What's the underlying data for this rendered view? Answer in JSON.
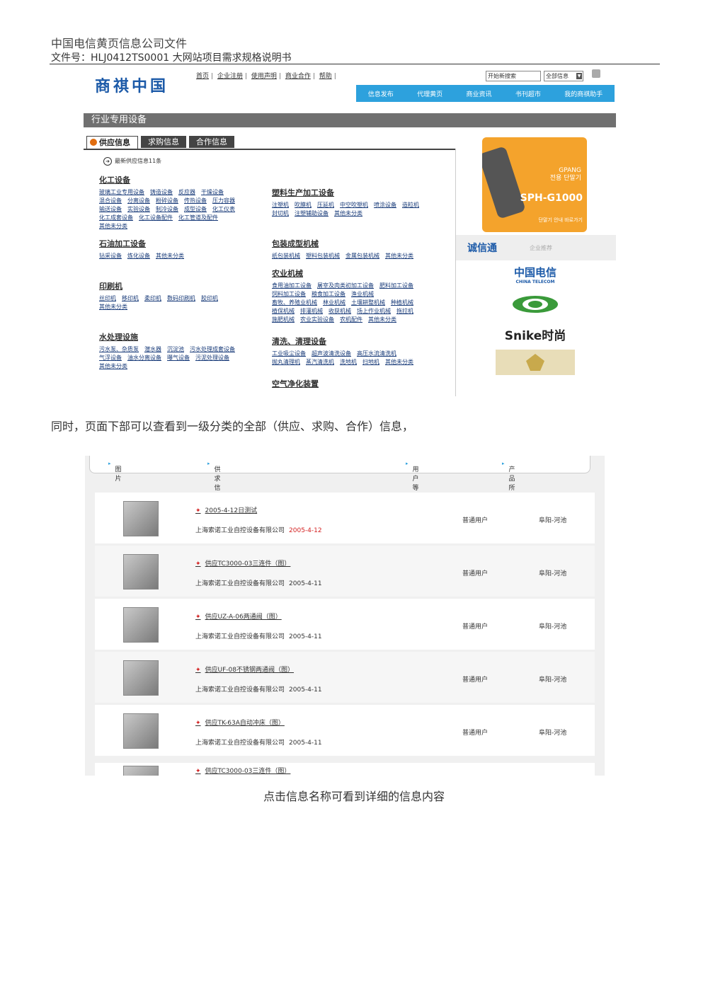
{
  "doc": {
    "header_line1": "中国电信黄页信息公司文件",
    "header_line2": "文件号：HLJ0412TS0001 大网站项目需求规格说明书",
    "caption1": "同时，页面下部可以查看到一级分类的全部（供应、求购、合作）信息，",
    "caption2": "点击信息名称可看到详细的信息内容"
  },
  "site": {
    "logo": "商祺中国",
    "topnav": [
      "首页",
      "企业注册",
      "使用声明",
      "商业合作",
      "帮助"
    ],
    "search_placeholder": "开始新搜索",
    "scope": "全部信息",
    "bluebar": [
      "信息发布",
      "代理黄页",
      "商业资讯",
      "书刊超市",
      "我的商祺助手"
    ],
    "category_title": "行业专用设备",
    "tabs": [
      "供应信息",
      "求购信息",
      "合作信息"
    ],
    "latest": "最新供应信息11条"
  },
  "categories": [
    {
      "title": "化工设备",
      "items": [
        "玻璃工业专用设备",
        "铸造设备",
        "反应器",
        "干燥设备",
        "混合设备",
        "分离设备",
        "粉碎设备",
        "传热设备",
        "压力容器",
        "输送设备",
        "实验设备",
        "制冷设备",
        "成型设备",
        "化工仪表",
        "化工成套设备",
        "化工设备配件",
        "化工管道及配件",
        "其他未分类"
      ]
    },
    {
      "title": "塑料生产加工设备",
      "items": [
        "注塑机",
        "吹膜机",
        "压延机",
        "中空吹塑机",
        "喷涂设备",
        "造粒机",
        "封切机",
        "注塑辅助设备",
        "其他未分类"
      ]
    },
    {
      "title": "石油加工设备",
      "items": [
        "钻采设备",
        "炼化设备",
        "其他未分类"
      ]
    },
    {
      "title": "包装成型机械",
      "items": [
        "纸包装机械",
        "塑料包装机械",
        "金属包装机械",
        "其他未分类"
      ]
    },
    {
      "title": "农业机械",
      "items": [
        "食用油加工设备",
        "屠宰及肉类初加工设备",
        "肥料加工设备",
        "饲料加工设备",
        "粮食加工设备",
        "渔业机械",
        "畜牧、养殖业机械",
        "林业机械",
        "土壤耕整机械",
        "种植机械",
        "植保机械",
        "排灌机械",
        "收获机械",
        "场上作业机械",
        "拖拉机",
        "施肥机械",
        "农业实验设备",
        "农机配件",
        "其他未分类"
      ]
    },
    {
      "title": "印刷机",
      "items": [
        "丝印机",
        "移印机",
        "柔印机",
        "数码印刷机",
        "胶印机",
        "其他未分类"
      ]
    },
    {
      "title": "水处理设施",
      "items": [
        "污水泵、杂质泵",
        "潜水器",
        "沉淀池",
        "污水处理成套设备",
        "气浮设备",
        "油水分离设备",
        "曝气设备",
        "污泥处理设备",
        "其他未分类"
      ]
    },
    {
      "title": "清洗、清理设备",
      "items": [
        "工业吸尘设备",
        "超声波清洗设备",
        "高压水流清洗机",
        "抛丸清理机",
        "蒸汽清洗机",
        "洗地机",
        "扫地机",
        "其他未分类"
      ]
    },
    {
      "title": "空气净化装置",
      "items": []
    }
  ],
  "ads": {
    "phone_line1": "GPANG",
    "phone_line2": "전용 단말기",
    "phone_model": "SPH-G1000",
    "phone_line3": "단말기 안내 바로가기",
    "cxt_logo": "诚信通",
    "cxt_sub": "企业推荐",
    "brand1": "中国电信",
    "brand1_sub": "CHINA TELECOM",
    "brand3": "Snike时尚"
  },
  "list": {
    "headers": [
      "图 片",
      "供求信息/公司",
      "用户等级",
      "产品所在地"
    ],
    "rows": [
      {
        "title": "2005-4-12日测试",
        "company": "上海索诺工业自控设备有限公司",
        "date": "2005-4-12",
        "grade": "普通用户",
        "loc": "阜阳-河池"
      },
      {
        "title": "供应TC3000-03三连件（图）",
        "company": "上海索诺工业自控设备有限公司",
        "date": "2005-4-11",
        "grade": "普通用户",
        "loc": "阜阳-河池"
      },
      {
        "title": "供应UZ-A-06两通阀（图）",
        "company": "上海索诺工业自控设备有限公司",
        "date": "2005-4-11",
        "grade": "普通用户",
        "loc": "阜阳-河池"
      },
      {
        "title": "供应UF-08不锈钢两通阀（图）",
        "company": "上海索诺工业自控设备有限公司",
        "date": "2005-4-11",
        "grade": "普通用户",
        "loc": "阜阳-河池"
      },
      {
        "title": "供应TK-63A自动冲床（图）",
        "company": "上海索诺工业自控设备有限公司",
        "date": "2005-4-11",
        "grade": "普通用户",
        "loc": "阜阳-河池"
      }
    ],
    "partial_title": "供应TC3000-03三连件（图）"
  }
}
